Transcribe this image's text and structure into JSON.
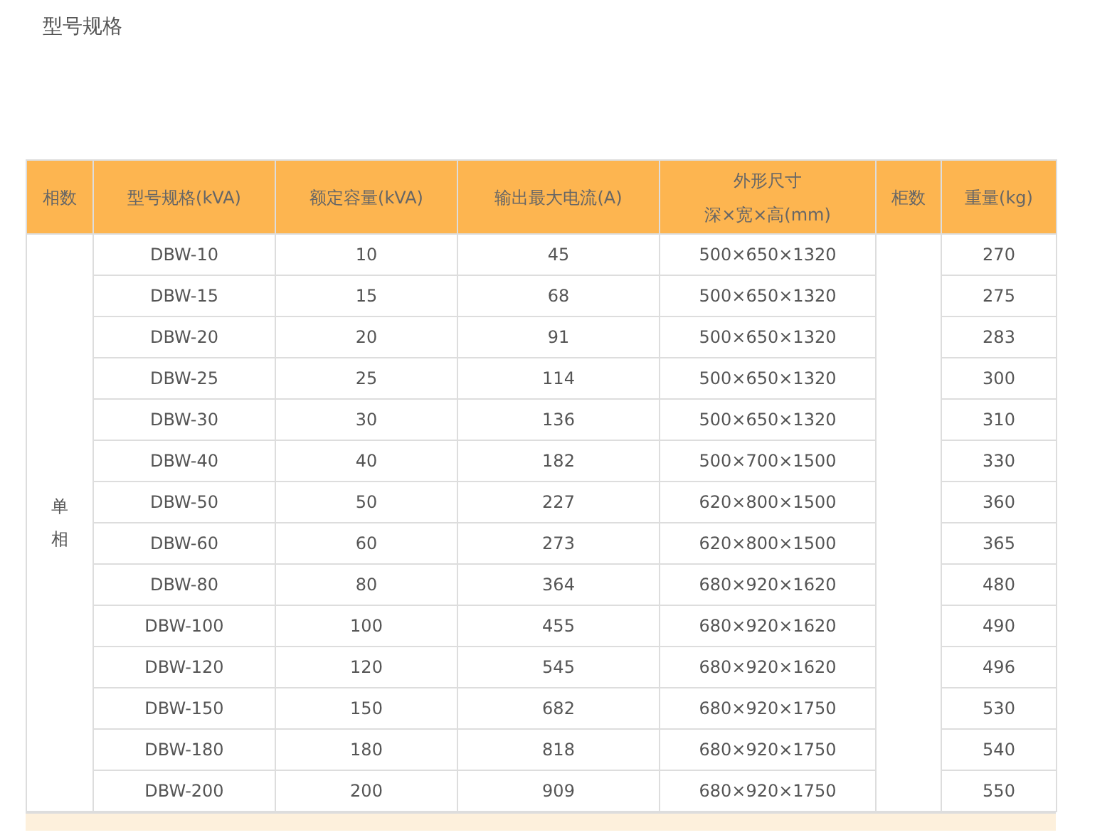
{
  "title": "型号规格",
  "table": {
    "columns": [
      {
        "lines": [
          "相数"
        ]
      },
      {
        "lines": [
          "型号规格(kVA)"
        ]
      },
      {
        "lines": [
          "额定容量(kVA)"
        ]
      },
      {
        "lines": [
          "输出最大电流(A)"
        ]
      },
      {
        "lines": [
          "外形尺寸",
          "深×宽×高(mm)"
        ]
      },
      {
        "lines": [
          "柜数"
        ]
      },
      {
        "lines": [
          "重量(kg)"
        ]
      }
    ],
    "phase": "单相",
    "rows": [
      {
        "model": "DBW-10",
        "capacity": "10",
        "current": "45",
        "size": "500×650×1320",
        "weight": "270"
      },
      {
        "model": "DBW-15",
        "capacity": "15",
        "current": "68",
        "size": "500×650×1320",
        "weight": "275"
      },
      {
        "model": "DBW-20",
        "capacity": "20",
        "current": "91",
        "size": "500×650×1320",
        "weight": "283"
      },
      {
        "model": "DBW-25",
        "capacity": "25",
        "current": "114",
        "size": "500×650×1320",
        "weight": "300"
      },
      {
        "model": "DBW-30",
        "capacity": "30",
        "current": "136",
        "size": "500×650×1320",
        "weight": "310"
      },
      {
        "model": "DBW-40",
        "capacity": "40",
        "current": "182",
        "size": "500×700×1500",
        "weight": "330"
      },
      {
        "model": "DBW-50",
        "capacity": "50",
        "current": "227",
        "size": "620×800×1500",
        "weight": "360"
      },
      {
        "model": "DBW-60",
        "capacity": "60",
        "current": "273",
        "size": "620×800×1500",
        "weight": "365"
      },
      {
        "model": "DBW-80",
        "capacity": "80",
        "current": "364",
        "size": "680×920×1620",
        "weight": "480"
      },
      {
        "model": "DBW-100",
        "capacity": "100",
        "current": "455",
        "size": "680×920×1620",
        "weight": "490"
      },
      {
        "model": "DBW-120",
        "capacity": "120",
        "current": "545",
        "size": "680×920×1620",
        "weight": "496"
      },
      {
        "model": "DBW-150",
        "capacity": "150",
        "current": "682",
        "size": "680×920×1750",
        "weight": "530"
      },
      {
        "model": "DBW-180",
        "capacity": "180",
        "current": "818",
        "size": "680×920×1750",
        "weight": "540"
      },
      {
        "model": "DBW-200",
        "capacity": "200",
        "current": "909",
        "size": "680×920×1750",
        "weight": "550"
      }
    ]
  }
}
